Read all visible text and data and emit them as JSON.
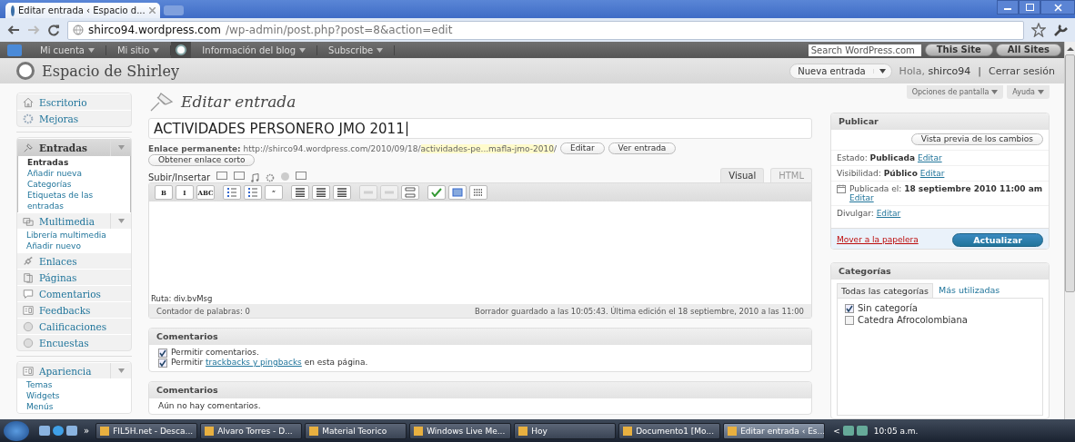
{
  "browser": {
    "tab_title": "Editar entrada ‹ Espacio d...",
    "url_host": "shirco94.wordpress.com",
    "url_path": "/wp-admin/post.php?post=8&action=edit"
  },
  "admin_bar": {
    "items": [
      {
        "kind": "logo"
      },
      {
        "kind": "menu",
        "label": "Mi cuenta"
      },
      {
        "kind": "menu",
        "label": "Mi sitio"
      },
      {
        "kind": "blog"
      },
      {
        "kind": "menu",
        "label": "Información del blog"
      },
      {
        "kind": "menu",
        "label": "Subscribe"
      }
    ],
    "search_placeholder": "Search WordPress.com",
    "buttons": [
      "This Site",
      "All Sites"
    ]
  },
  "header": {
    "site_title": "Espacio de Shirley",
    "new_post": "Nueva entrada",
    "greeting": "Hola,",
    "username": "shirco94",
    "separator": "|",
    "logout": "Cerrar sesión"
  },
  "screen_tabs": [
    "Opciones de pantalla",
    "Ayuda"
  ],
  "sidebar": {
    "sections": [
      {
        "items": [
          {
            "label": "Escritorio",
            "kind": "house",
            "selected": false
          },
          {
            "label": "Mejoras",
            "kind": "gear",
            "selected": false
          }
        ]
      },
      {
        "items": [
          {
            "label": "Entradas",
            "kind": "pin",
            "selected": true,
            "expanded": true,
            "children": [
              {
                "label": "Entradas",
                "selected": true
              },
              {
                "label": "Añadir nueva",
                "selected": false
              },
              {
                "label": "Categorías",
                "selected": false
              },
              {
                "label": "Etiquetas de las entradas",
                "selected": false
              }
            ]
          },
          {
            "label": "Multimedia",
            "kind": "media",
            "selected": false,
            "expanded": true,
            "children": [
              {
                "label": "Librería multimedia",
                "selected": false
              },
              {
                "label": "Añadir nuevo",
                "selected": false
              }
            ]
          },
          {
            "label": "Enlaces",
            "kind": "link",
            "selected": false
          },
          {
            "label": "Páginas",
            "kind": "page",
            "selected": false
          },
          {
            "label": "Comentarios",
            "kind": "bubble",
            "selected": false
          },
          {
            "label": "Feedbacks",
            "kind": "form",
            "selected": false
          },
          {
            "label": "Calificaciones",
            "kind": "circle",
            "selected": false
          },
          {
            "label": "Encuestas",
            "kind": "circle",
            "selected": false
          }
        ]
      },
      {
        "items": [
          {
            "label": "Apariencia",
            "kind": "form",
            "selected": false,
            "expanded": true,
            "children": [
              {
                "label": "Temas",
                "selected": false
              },
              {
                "label": "Widgets",
                "selected": false
              },
              {
                "label": "Menús",
                "selected": false
              }
            ]
          }
        ]
      }
    ]
  },
  "editor": {
    "heading": "Editar entrada",
    "title": "ACTIVIDADES PERSONERO JMO 2011",
    "permalink_label": "Enlace permanente:",
    "permalink_base": "http://shirco94.wordpress.com/2010/09/18/",
    "permalink_slug": "actividades-pe...mafla-jmo-2010",
    "permalink_end": "/",
    "permalink_buttons": [
      "Editar",
      "Ver entrada"
    ],
    "shortlink_button": "Obtener enlace corto",
    "upload_label": "Subir/Insertar",
    "tabs": [
      {
        "label": "Visual",
        "selected": true
      },
      {
        "label": "HTML",
        "selected": false
      }
    ],
    "toolbar": [
      {
        "kind": "text",
        "label": "B",
        "disabled": false
      },
      {
        "kind": "text",
        "label": "I",
        "disabled": false
      },
      {
        "kind": "text",
        "label": "ABC",
        "disabled": false
      },
      {
        "kind": "bullets",
        "disabled": false
      },
      {
        "kind": "numbers",
        "disabled": false
      },
      {
        "kind": "text",
        "label": "“",
        "disabled": false
      },
      {
        "kind": "align",
        "disabled": false
      },
      {
        "kind": "align",
        "disabled": false
      },
      {
        "kind": "align",
        "disabled": false
      },
      {
        "kind": "link",
        "disabled": true
      },
      {
        "kind": "unlink",
        "disabled": true
      },
      {
        "kind": "more",
        "disabled": false
      },
      {
        "kind": "spell",
        "disabled": false
      },
      {
        "kind": "screen",
        "disabled": false
      },
      {
        "kind": "grid",
        "disabled": false
      }
    ],
    "path": "Ruta: div.bvMsg",
    "word_count": "Contador de palabras: 0",
    "draft_status": "Borrador guardado a las 10:05:43. Última edición el 18 septiembre, 2010 a las 11:00"
  },
  "discussion_box": {
    "title": "Comentarios",
    "options": [
      {
        "text": "Permitir comentarios.",
        "checked": true
      },
      {
        "text": "Permitir",
        "link": "trackbacks y pingbacks",
        "text_after": "en esta página.",
        "checked": true
      }
    ]
  },
  "comments_box": {
    "title": "Comentarios",
    "message": "Aún no hay comentarios."
  },
  "publish_box": {
    "title": "Publicar",
    "preview_button": "Vista previa de los cambios",
    "rows": [
      {
        "kind": "status",
        "label": "Estado:",
        "value": "Publicada",
        "link": "Editar"
      },
      {
        "kind": "status",
        "label": "Visibilidad:",
        "value": "Público",
        "link": "Editar"
      },
      {
        "kind": "date",
        "label": "Publicada el:",
        "value": "18 septiembre 2010 11:00 am",
        "link": "Editar"
      },
      {
        "kind": "status",
        "label": "Divulgar:",
        "link": "Editar"
      }
    ],
    "trash_link": "Mover a la papelera",
    "update_button": "Actualizar"
  },
  "categories_box": {
    "title": "Categorías",
    "tabs": [
      {
        "label": "Todas las categorías",
        "selected": true
      },
      {
        "label": "Más utilizadas",
        "selected": false
      }
    ],
    "items": [
      {
        "label": "Sin categoría",
        "checked": true
      },
      {
        "label": "Catedra Afrocolombiana",
        "checked": false
      }
    ]
  },
  "taskbar": {
    "overflow": "»",
    "items": [
      {
        "label": "FIL5H.net - Desca...",
        "selected": false
      },
      {
        "label": "Alvaro Torres - D...",
        "selected": false
      },
      {
        "label": "Material Teorico",
        "selected": false
      },
      {
        "label": "Windows Live Me...",
        "selected": false
      },
      {
        "label": "Hoy",
        "selected": false
      },
      {
        "label": "Documento1 [Mo...",
        "selected": false
      },
      {
        "label": "Editar entrada ‹ Es...",
        "selected": true
      }
    ],
    "tray_arrow": "<",
    "clock": "10:05 a.m."
  }
}
